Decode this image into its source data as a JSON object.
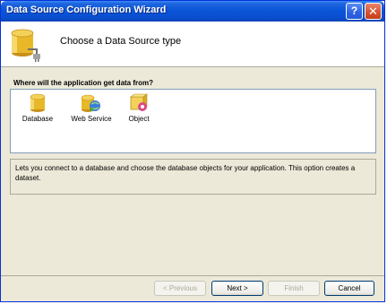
{
  "window": {
    "title": "Data Source Configuration Wizard",
    "help_glyph": "?",
    "close_glyph": "✕"
  },
  "header": {
    "title": "Choose a Data Source type"
  },
  "question": "Where will the application get data from?",
  "data_source_types": [
    {
      "label": "Database",
      "icon": "database-icon",
      "selected": true
    },
    {
      "label": "Web Service",
      "icon": "web-service-icon",
      "selected": false
    },
    {
      "label": "Object",
      "icon": "object-icon",
      "selected": false
    }
  ],
  "description": "Lets you connect to a database and choose the database objects for your application. This option creates a dataset.",
  "buttons": {
    "previous": "< Previous",
    "next": "Next >",
    "finish": "Finish",
    "cancel": "Cancel"
  },
  "colors": {
    "titlebar": "#0a55d8",
    "window_bg": "#ece9d8",
    "panel_border": "#7f9db9",
    "cylinder": "#e8b828"
  }
}
